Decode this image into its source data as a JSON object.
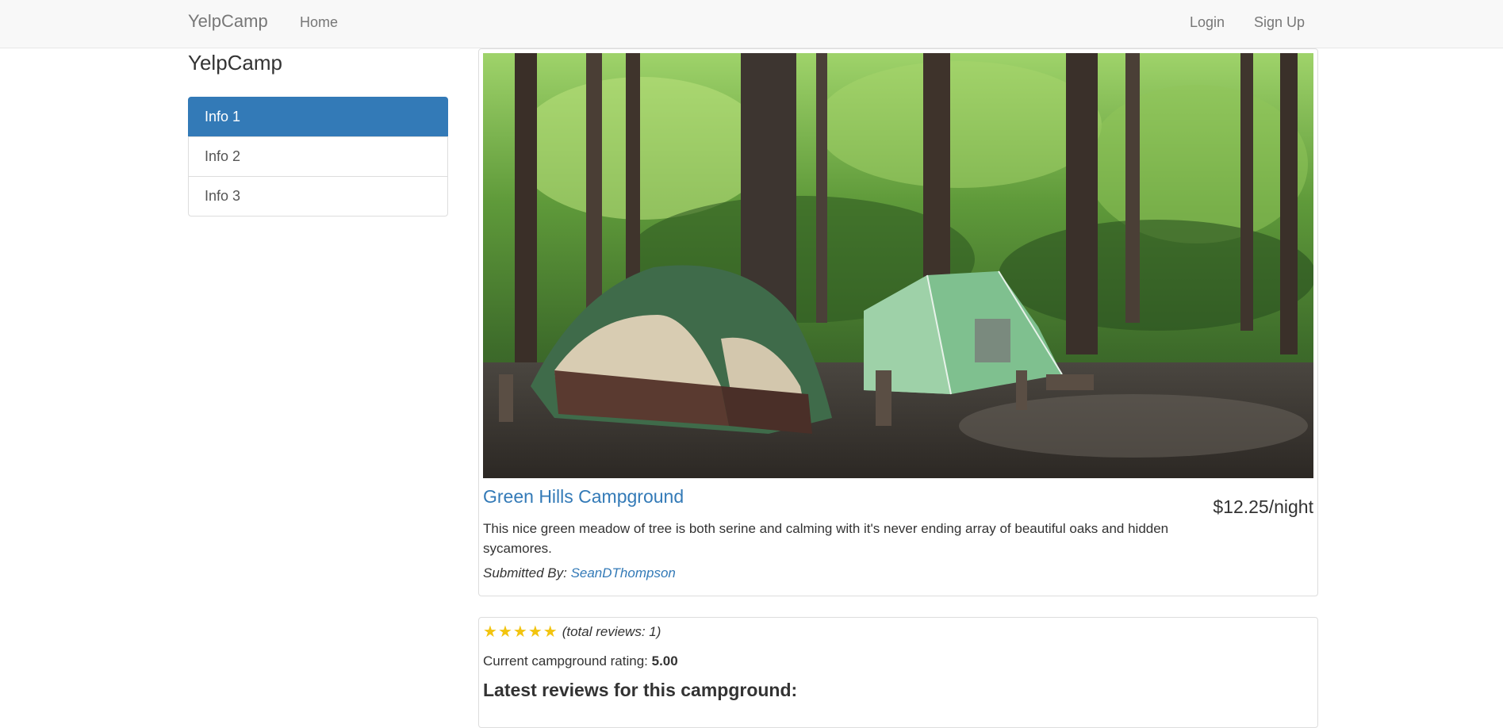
{
  "navbar": {
    "brand": "YelpCamp",
    "home": "Home",
    "login": "Login",
    "signup": "Sign Up"
  },
  "sidebar": {
    "title": "YelpCamp",
    "items": [
      {
        "label": "Info 1",
        "active": true
      },
      {
        "label": "Info 2",
        "active": false
      },
      {
        "label": "Info 3",
        "active": false
      }
    ]
  },
  "campground": {
    "name": "Green Hills Campground",
    "price": "$12.25/night",
    "description": "This nice green meadow of tree is both serine and calming with it's never ending array of beautiful oaks and hidden sycamores.",
    "submitted_label": "Submitted By:",
    "author": "SeanDThompson"
  },
  "reviews": {
    "stars": 5,
    "total": "(total reviews: 1)",
    "rating_label": "Current campground rating:",
    "rating_value": "5.00",
    "latest_heading": "Latest reviews for this campground:"
  },
  "colors": {
    "accent": "#337ab7",
    "star": "#f2c40f",
    "navbar_bg": "#f8f8f8"
  }
}
